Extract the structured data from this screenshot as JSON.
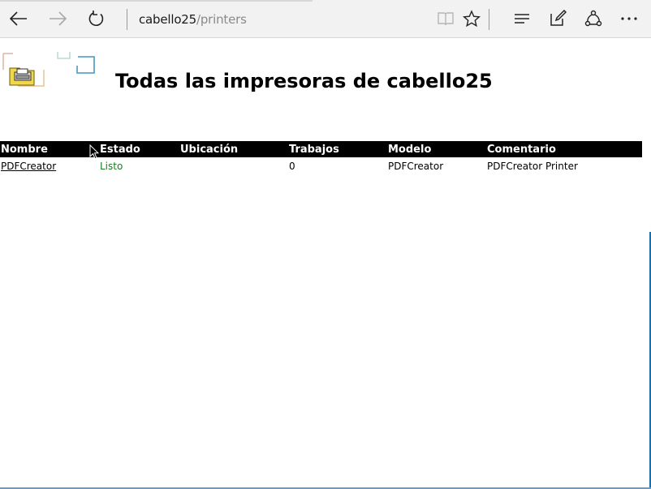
{
  "browser": {
    "address_host": "cabello25",
    "address_path": "/printers",
    "icons": [
      "back-arrow-icon",
      "forward-arrow-icon",
      "refresh-icon",
      "reading-view-icon",
      "favorite-star-icon",
      "hub-icon",
      "web-note-icon",
      "share-icon",
      "more-icon"
    ]
  },
  "page": {
    "title": "Todas las impresoras de cabello25"
  },
  "table": {
    "headers": [
      "Nombre",
      "Estado",
      "Ubicación",
      "Trabajos",
      "Modelo",
      "Comentario"
    ],
    "rows": [
      {
        "name": "PDFCreator",
        "status": "Listo",
        "location": "",
        "jobs": "0",
        "model": "PDFCreator",
        "comment": "PDFCreator Printer"
      }
    ]
  },
  "colors": {
    "header_bg": "#000000",
    "header_text": "#ffffff",
    "status_ready": "#1a7f1a",
    "toolbar_bg": "#f2f2f2"
  }
}
